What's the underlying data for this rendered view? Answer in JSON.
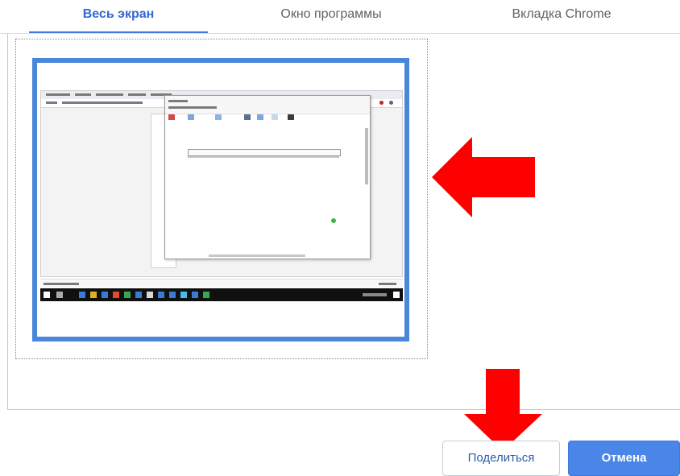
{
  "tabs": [
    {
      "label": "Весь экран",
      "active": true
    },
    {
      "label": "Окно программы",
      "active": false
    },
    {
      "label": "Вкладка Chrome",
      "active": false
    }
  ],
  "buttons": {
    "share_label": "Поделиться",
    "cancel_label": "Отмена"
  },
  "colors": {
    "accent": "#3f7be0",
    "thumbnail_border": "#4a86d9",
    "primary_button": "#4a86e8",
    "annotation_arrow": "#ff0000"
  },
  "icons": {
    "annotation_right": "arrow-left-icon",
    "annotation_down": "arrow-down-icon"
  }
}
